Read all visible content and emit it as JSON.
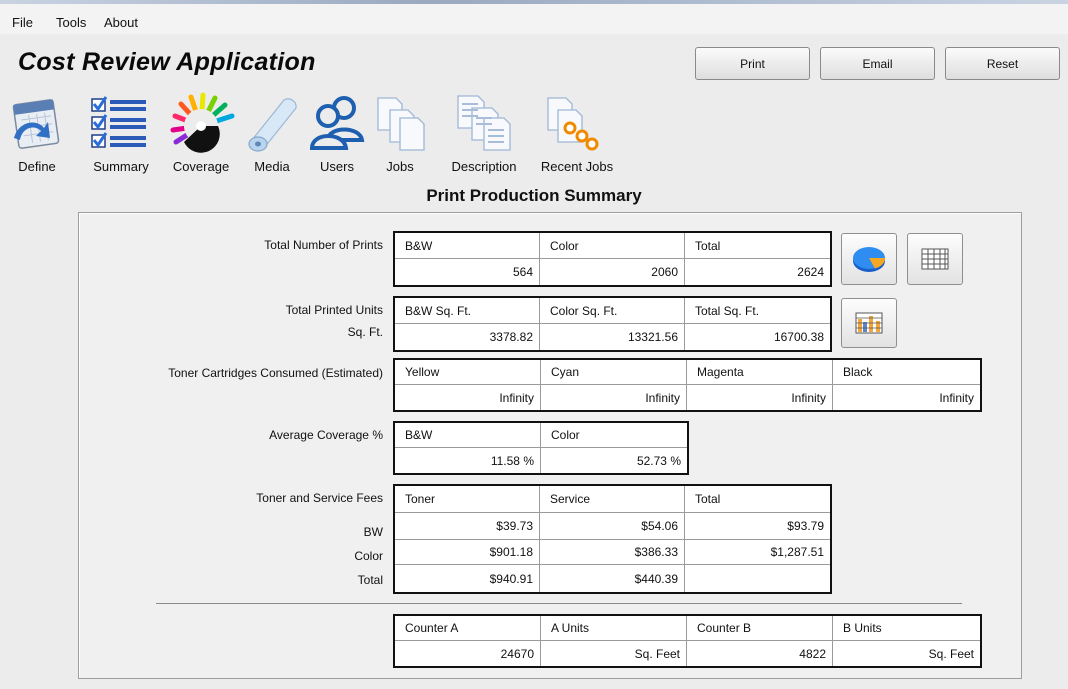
{
  "menu": [
    "File",
    "Tools",
    "About"
  ],
  "app_title": "Cost Review Application",
  "buttons": {
    "print": "Print",
    "email": "Email",
    "reset": "Reset"
  },
  "toolbar": [
    {
      "label": "Define",
      "icon": "calendar-refresh-icon"
    },
    {
      "label": "Summary",
      "icon": "checklist-icon"
    },
    {
      "label": "Coverage",
      "icon": "color-wheel-icon"
    },
    {
      "label": "Media",
      "icon": "paper-roll-icon"
    },
    {
      "label": "Users",
      "icon": "users-icon"
    },
    {
      "label": "Jobs",
      "icon": "documents-icon"
    },
    {
      "label": "Description",
      "icon": "document-lines-icon"
    },
    {
      "label": "Recent Jobs",
      "icon": "recent-documents-icon"
    }
  ],
  "section_title": "Print Production Summary",
  "total_prints": {
    "label": "Total Number of Prints",
    "headers": [
      "B&W",
      "Color",
      "Total"
    ],
    "values": [
      "564",
      "2060",
      "2624"
    ]
  },
  "printed_units": {
    "label": "Total Printed Units",
    "sublabel": "Sq. Ft.",
    "headers": [
      "B&W Sq. Ft.",
      "Color Sq. Ft.",
      "Total Sq. Ft."
    ],
    "values": [
      "3378.82",
      "13321.56",
      "16700.38"
    ]
  },
  "toner": {
    "label": "Toner Cartridges Consumed  (Estimated)",
    "headers": [
      "Yellow",
      "Cyan",
      "Magenta",
      "Black"
    ],
    "values": [
      "Infinity",
      "Infinity",
      "Infinity",
      "Infinity"
    ]
  },
  "coverage": {
    "label": "Average Coverage %",
    "headers": [
      "B&W",
      "Color"
    ],
    "values": [
      "11.58 %",
      "52.73 %"
    ]
  },
  "fees": {
    "label": "Toner and Service Fees",
    "row_labels": [
      "BW",
      "Color",
      "Total"
    ],
    "headers": [
      "Toner",
      "Service",
      "Total"
    ],
    "rows": [
      [
        "$39.73",
        "$54.06",
        "$93.79"
      ],
      [
        "$901.18",
        "$386.33",
        "$1,287.51"
      ],
      [
        "$940.91",
        "$440.39",
        ""
      ]
    ]
  },
  "counters": {
    "headers": [
      "Counter A",
      "A Units",
      "Counter B",
      "B Units"
    ],
    "values": [
      "24670",
      "Sq. Feet",
      "4822",
      "Sq. Feet"
    ]
  }
}
